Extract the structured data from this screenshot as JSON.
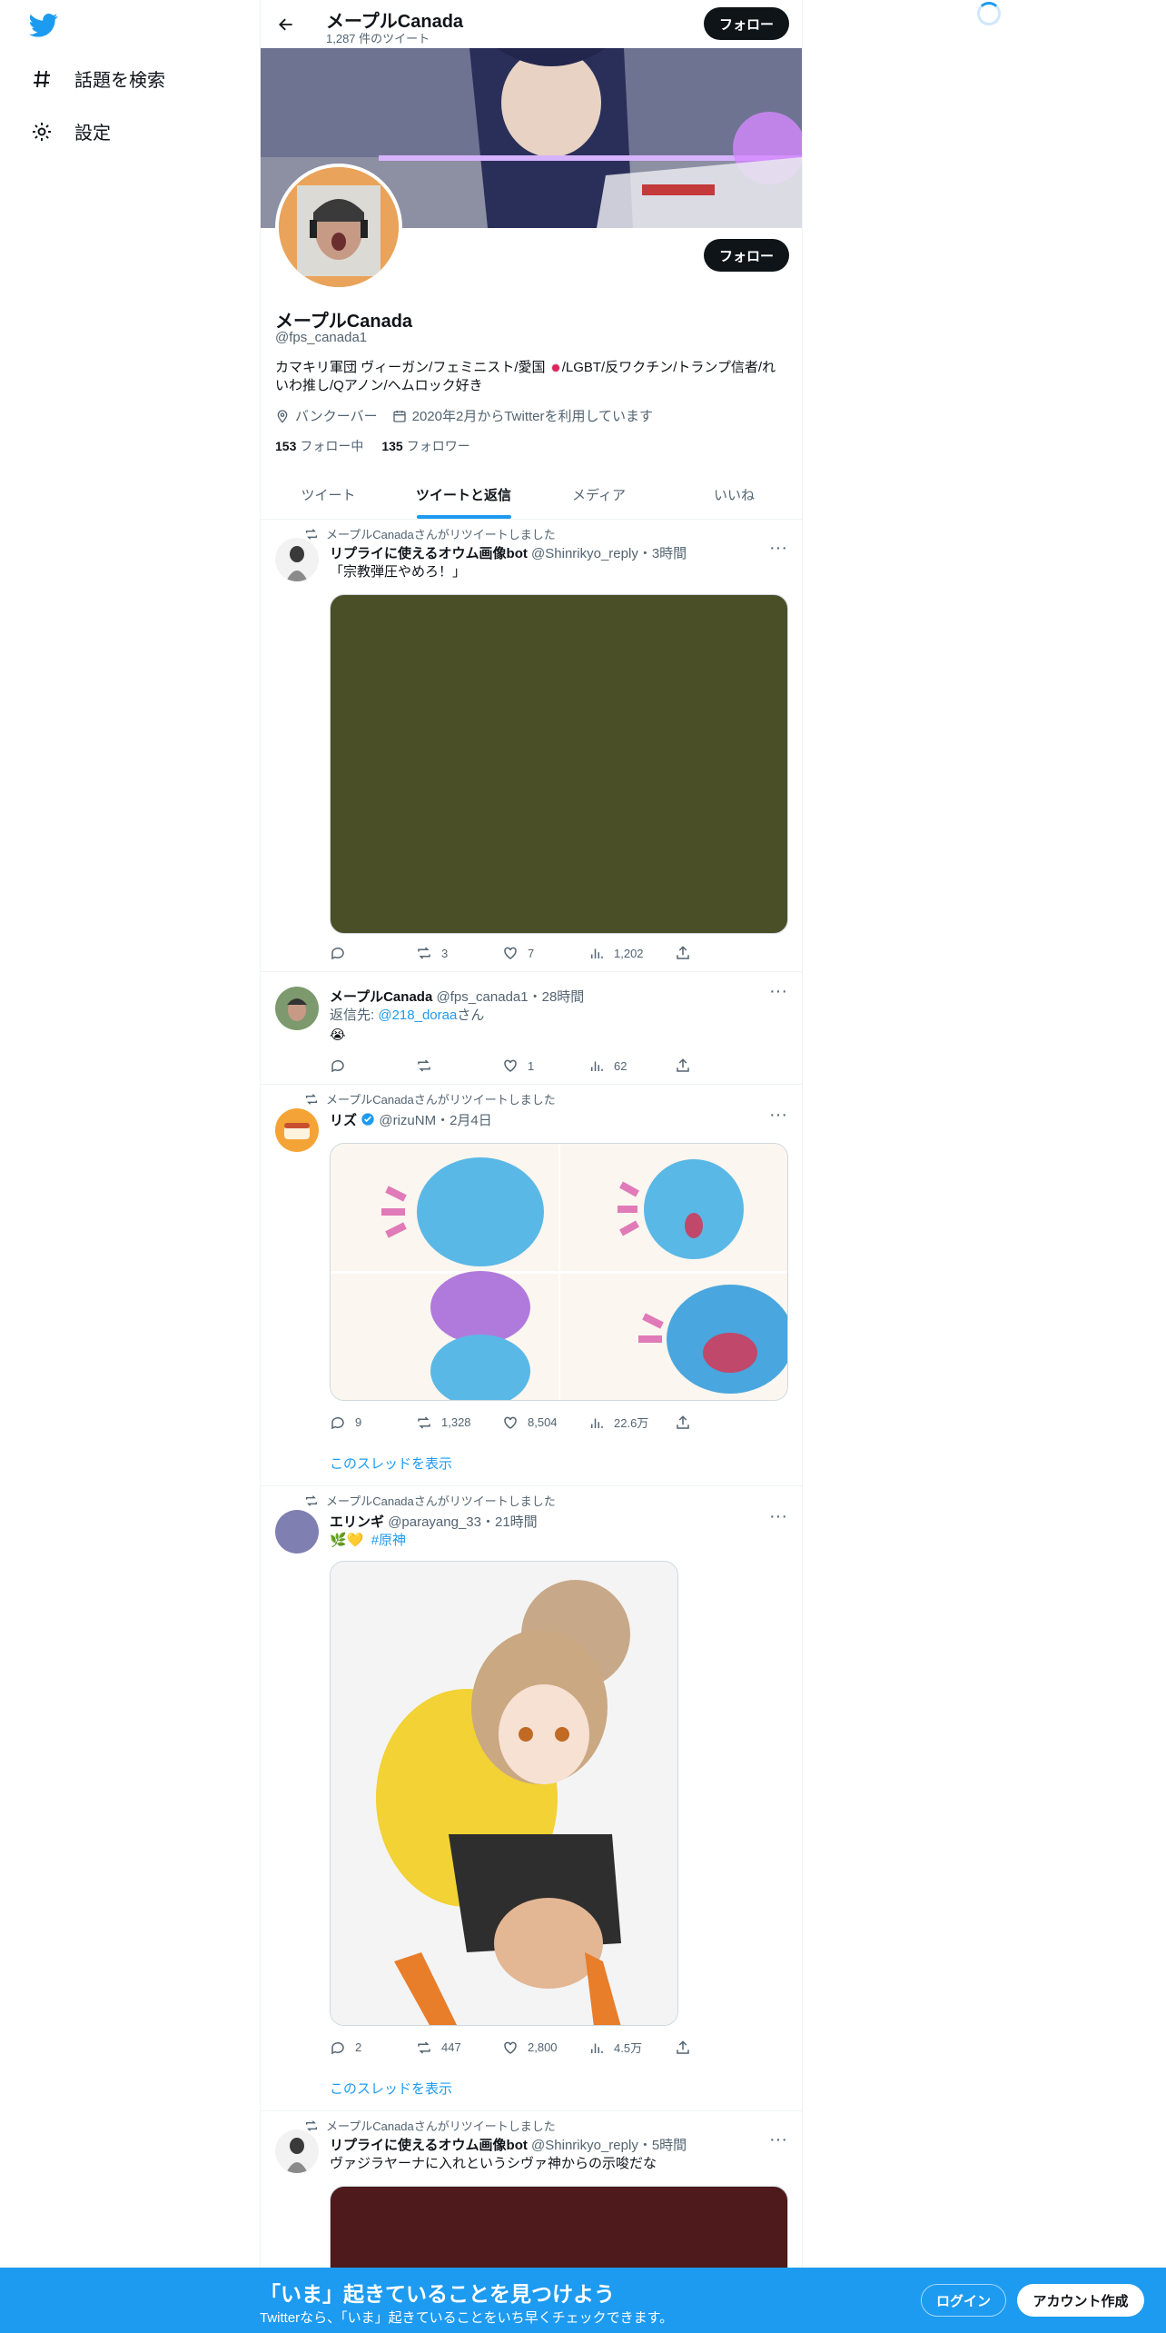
{
  "nav": {
    "explore_label": "話題を検索",
    "settings_label": "設定"
  },
  "header": {
    "name": "メープルCanada",
    "tweet_count": "1,287 件のツイート",
    "follow_label": "フォロー"
  },
  "profile": {
    "name": "メープルCanada",
    "handle": "@fps_canada1",
    "bio_line1_a": "カマキリ軍団 ヴィーガン/フェミニスト/愛国",
    "bio_line1_b": "/LGBT/反ワクチン/トランプ信者/れ",
    "bio_line2": "いわ推し/Qアノン/ヘムロック好き",
    "location": "バンクーバー",
    "joined": "2020年2月からTwitterを利用しています",
    "following_count": "153",
    "following_label": "フォロー中",
    "followers_count": "135",
    "followers_label": "フォロワー",
    "follow_label": "フォロー"
  },
  "tabs": [
    {
      "label": "ツイート"
    },
    {
      "label": "ツイートと返信"
    },
    {
      "label": "メディア"
    },
    {
      "label": "いいね"
    }
  ],
  "tweets": [
    {
      "retweet_by": "メープルCanadaさんがリツイートしました",
      "name": "リプライに使えるオウム画像bot",
      "handle": "@Shinrikyo_reply",
      "time": "・3時間",
      "text": "「宗教弾圧やめろ！」",
      "media_color": "#4a4f27",
      "reply": "",
      "retweets": "3",
      "likes": "7",
      "views": "1,202"
    },
    {
      "name": "メープルCanada",
      "handle": "@fps_canada1",
      "time": "・28時間",
      "reply_prefix": "返信先: ",
      "reply_to": "@218_doraa",
      "reply_suffix": "さん",
      "text": "😭",
      "reply": "",
      "retweets": "",
      "likes": "1",
      "views": "62"
    },
    {
      "retweet_by": "メープルCanadaさんがリツイートしました",
      "name": "リズ",
      "handle": "@rizuNM",
      "time": "・2月4日",
      "reply": "9",
      "retweets": "1,328",
      "likes": "8,504",
      "views": "22.6万",
      "thread": "このスレッドを表示"
    },
    {
      "retweet_by": "メープルCanadaさんがリツイートしました",
      "name": "エリンギ",
      "handle": "@parayang_33",
      "time": "・21時間",
      "text": "🌿💛",
      "hashtag": "#原神",
      "reply": "2",
      "retweets": "447",
      "likes": "2,800",
      "views": "4.5万",
      "thread": "このスレッドを表示"
    },
    {
      "retweet_by": "メープルCanadaさんがリツイートしました",
      "name": "リプライに使えるオウム画像bot",
      "handle": "@Shinrikyo_reply",
      "time": "・5時間",
      "text": "ヴァジラヤーナに入れというシヴァ神からの示唆だな",
      "media_color": "#4e1a1c"
    }
  ],
  "bottom_bar": {
    "title": "「いま」起きていることを見つけよう",
    "subtitle": "Twitterなら、「いま」起きていることをいち早くチェックできます。",
    "login_label": "ログイン",
    "signup_label": "アカウント作成"
  },
  "colors": {
    "accent": "#1d9bf0",
    "text": "#0f1419",
    "secondary": "#536471"
  }
}
